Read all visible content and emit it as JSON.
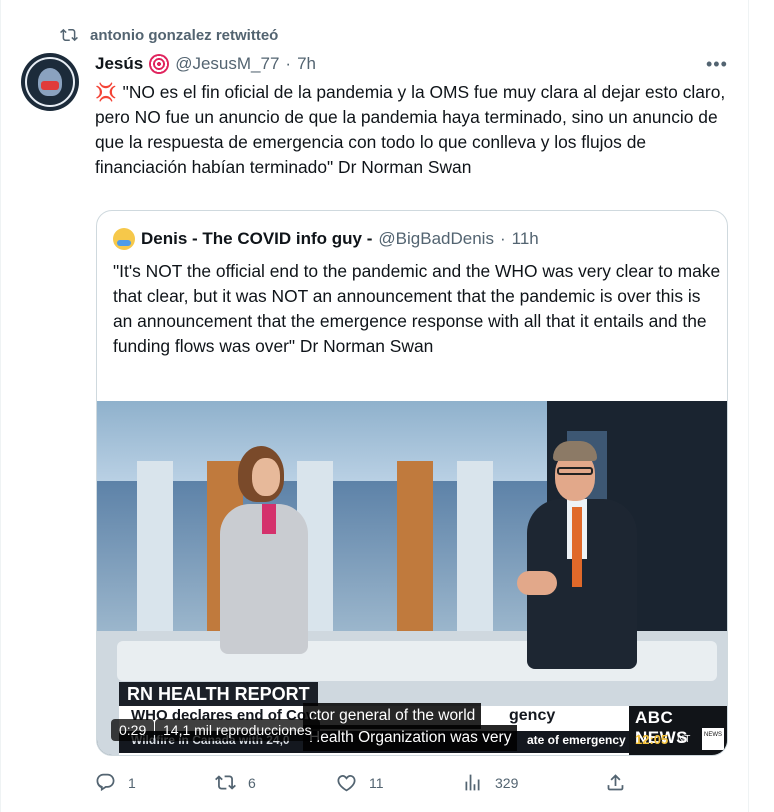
{
  "retweet": {
    "label": "antonio gonzalez retwitteó",
    "icon": "retweet-icon"
  },
  "tweet": {
    "author_name": "Jesús",
    "author_emoji": "target-icon",
    "handle": "@JesusM_77",
    "separator": "·",
    "time": "7h",
    "more_label": "•••",
    "lead_emoji": "anger-icon",
    "text": "\"NO es el fin oficial de la pandemia y la OMS fue muy clara al dejar esto claro, pero NO fue un anuncio de que la pandemia haya terminado, sino un anuncio de que la respuesta de emergencia con todo lo que conlleva y los flujos de financiación habían terminado\" Dr Norman Swan"
  },
  "quote": {
    "author_name": "Denis - The COVID info guy -",
    "handle": "@BigBadDenis",
    "separator": "·",
    "time": "11h",
    "text": "\"It's NOT the official end to the pandemic and the WHO was very clear to make that clear, but it was NOT an announcement that the pandemic is over this is an announcement that the emergence response with all that it entails and the funding flows was over\" Dr Norman Swan"
  },
  "video": {
    "segment_label": "RN HEALTH REPORT",
    "ticker_left": "WHO declares end of Cov",
    "ticker_left_sub": "Wildfire in Canada with 24,0",
    "ticker_topic": "gency",
    "ticker_sub": "ate of emergency",
    "caption_line1": "ctor general of the world",
    "caption_line2": "Health Organization was very",
    "news_logo": "ABC NEWS",
    "news_time": "12:05",
    "news_tz": "NT",
    "badge": "NEWS",
    "timecode": "0:29",
    "views": "14,1 mil reproducciones"
  },
  "actions": {
    "reply_count": "1",
    "retweet_count": "6",
    "like_count": "11",
    "views_count": "329"
  },
  "colors": {
    "secondary_text": "#536471",
    "border": "#cfd9de",
    "accent_red": "#e0245e",
    "news_yellow": "#f4c23a"
  }
}
